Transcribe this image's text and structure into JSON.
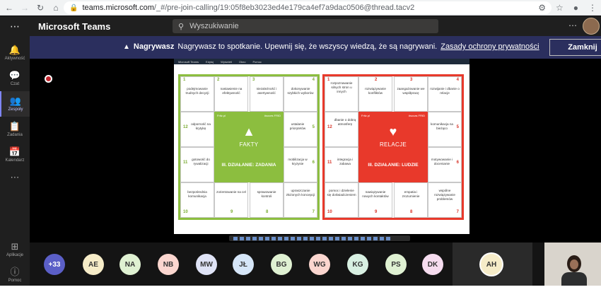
{
  "browser": {
    "url_host": "teams.microsoft.com",
    "url_path": "/_#/pre-join-calling/19:05f8eb3023ed4e179ca4ef7a9dac0506@thread.tacv2"
  },
  "header": {
    "app_title": "Microsoft Teams",
    "search_placeholder": "Wyszukiwanie"
  },
  "rail": {
    "items": [
      {
        "label": "Aktywność",
        "icon": "bell-icon"
      },
      {
        "label": "Czat",
        "icon": "chat-icon"
      },
      {
        "label": "Zespoły",
        "icon": "teams-icon"
      },
      {
        "label": "Zadania",
        "icon": "tasks-icon"
      },
      {
        "label": "Kalendarz",
        "icon": "calendar-icon"
      },
      {
        "label": "Aplikacje",
        "icon": "apps-icon"
      },
      {
        "label": "Pomoc",
        "icon": "help-icon"
      }
    ]
  },
  "banner": {
    "bold": "Nagrywasz",
    "message": "Nagrywasz to spotkanie. Upewnij się, że wszyscy wiedzą, że są nagrywani.",
    "link": "Zasady ochrony prywatności",
    "close_label": "Zamknij"
  },
  "slide": {
    "bar_items": [
      "Microsoft Teams",
      "Edytuj",
      "Wyświetl",
      "Okno",
      "Pomoc"
    ],
    "green": {
      "top": [
        {
          "n": "1",
          "t": "podejmowanie trudnych decyzji"
        },
        {
          "n": "2",
          "t": "nastawienie na efektywność"
        },
        {
          "n": "3",
          "t": "niezależność i asertywność"
        },
        {
          "n": "4",
          "t": "dokonywanie szybkich wyborów"
        }
      ],
      "left": [
        {
          "n": "12",
          "t": "odporność na krytykę"
        },
        {
          "n": "11",
          "t": "gotowość do rywalizacji"
        }
      ],
      "right": [
        {
          "n": "5",
          "t": "ustalanie priorytetów"
        },
        {
          "n": "6",
          "t": "mobilizacja w kryzysie"
        }
      ],
      "bottom": [
        {
          "n": "10",
          "t": "bezpośrednia komunikacja"
        },
        {
          "n": "9",
          "t": "zorientowanie na cel"
        },
        {
          "n": "8",
          "t": "sprawowanie kontroli"
        },
        {
          "n": "7",
          "t": "upraszczanie złożonych koncepcji"
        }
      ],
      "tag_left": "Fritz.pl",
      "tag_right": "#soces FRID",
      "title": "FAKTY",
      "subtitle": "III. DZIAŁANIE: ZADANIA"
    },
    "red": {
      "top": [
        {
          "n": "1",
          "t": "rozpoznawanie silnych stron u innych"
        },
        {
          "n": "2",
          "t": "rozwiązywanie konfliktów"
        },
        {
          "n": "3",
          "t": "zaangażowanie we współpracę"
        },
        {
          "n": "4",
          "t": "rozwijanie i dbanie o relacje"
        }
      ],
      "left": [
        {
          "n": "12",
          "t": "dbanie o dobrą atmosferę"
        },
        {
          "n": "11",
          "t": "integracja i zabawa"
        }
      ],
      "right": [
        {
          "n": "5",
          "t": "komunikacja na bieżąco"
        },
        {
          "n": "6",
          "t": "motywowanie i docenianie"
        }
      ],
      "bottom": [
        {
          "n": "10",
          "t": "pomoc i dzielenie się doświadczeniem"
        },
        {
          "n": "9",
          "t": "nawiązywanie nowych kontaktów"
        },
        {
          "n": "8",
          "t": "empatia i zrozumienie"
        },
        {
          "n": "7",
          "t": "wspólne rozwiązywanie problemów"
        }
      ],
      "tag_left": "Fritz.pl",
      "tag_right": "#socas FRID",
      "title": "RELACJE",
      "subtitle": "III. DZIAŁANIE: LUDZIE"
    }
  },
  "participants": [
    {
      "initials": "+33",
      "color": "#5b5fc7",
      "text_color": "#ffffff"
    },
    {
      "initials": "AE",
      "color": "#f6ecc8",
      "text_color": "#333333"
    },
    {
      "initials": "NA",
      "color": "#dff1d2",
      "text_color": "#333333"
    },
    {
      "initials": "NB",
      "color": "#fbd6cf",
      "text_color": "#333333"
    },
    {
      "initials": "MW",
      "color": "#dfe3f6",
      "text_color": "#333333"
    },
    {
      "initials": "JŁ",
      "color": "#d6e6f8",
      "text_color": "#333333"
    },
    {
      "initials": "BG",
      "color": "#dff1d2",
      "text_color": "#333333"
    },
    {
      "initials": "WG",
      "color": "#fbd6cf",
      "text_color": "#333333"
    },
    {
      "initials": "KG",
      "color": "#d8f0e2",
      "text_color": "#333333"
    },
    {
      "initials": "PS",
      "color": "#dff1d2",
      "text_color": "#333333"
    },
    {
      "initials": "DK",
      "color": "#f6dcef",
      "text_color": "#333333"
    }
  ],
  "active_speaker": {
    "initials": "AH",
    "color": "#f6ecc8",
    "ring": "#ffffff"
  }
}
